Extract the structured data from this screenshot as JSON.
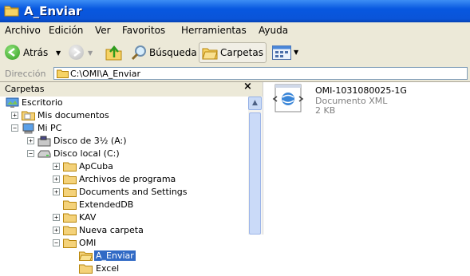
{
  "window": {
    "title": "A_Enviar"
  },
  "menu": {
    "items": [
      "Archivo",
      "Edición",
      "Ver",
      "Favoritos",
      "Herramientas",
      "Ayuda"
    ]
  },
  "toolbar": {
    "back_label": "Atrás",
    "search_label": "Búsqueda",
    "folders_label": "Carpetas"
  },
  "address": {
    "label": "Dirección",
    "value": "C:\\OMI\\A_Enviar"
  },
  "folders_pane": {
    "title": "Carpetas",
    "close_glyph": "×",
    "tree": [
      {
        "label": "Escritorio",
        "icon": "desktop-icon"
      },
      {
        "label": "Mis documentos",
        "icon": "folder-icon",
        "expander": "+"
      },
      {
        "label": "Mi PC",
        "icon": "computer-icon",
        "expander": "−"
      },
      {
        "label": "Disco de 3½ (A:)",
        "icon": "floppy-icon",
        "expander": "+"
      },
      {
        "label": "Disco local (C:)",
        "icon": "drive-icon",
        "expander": "−"
      },
      {
        "label": "ApCuba",
        "icon": "folder-icon",
        "expander": "+"
      },
      {
        "label": "Archivos de programa",
        "icon": "folder-icon",
        "expander": "+"
      },
      {
        "label": "Documents and Settings",
        "icon": "folder-icon",
        "expander": "+"
      },
      {
        "label": "ExtendedDB",
        "icon": "folder-icon"
      },
      {
        "label": "KAV",
        "icon": "folder-icon",
        "expander": "+"
      },
      {
        "label": "Nueva carpeta",
        "icon": "folder-icon",
        "expander": "+"
      },
      {
        "label": "OMI",
        "icon": "folder-icon",
        "expander": "−"
      },
      {
        "label": "A_Enviar",
        "icon": "open-folder-icon",
        "selected": true
      },
      {
        "label": "Excel",
        "icon": "folder-icon"
      }
    ]
  },
  "files": [
    {
      "name": "OMI-1031080025-1G",
      "type": "Documento XML",
      "size": "2 KB",
      "icon": "xml-document-icon"
    }
  ],
  "colors": {
    "title_bar": "#0a54d8",
    "selection": "#316ac5",
    "chrome": "#ece9d8",
    "folder": "#f4d27a"
  }
}
